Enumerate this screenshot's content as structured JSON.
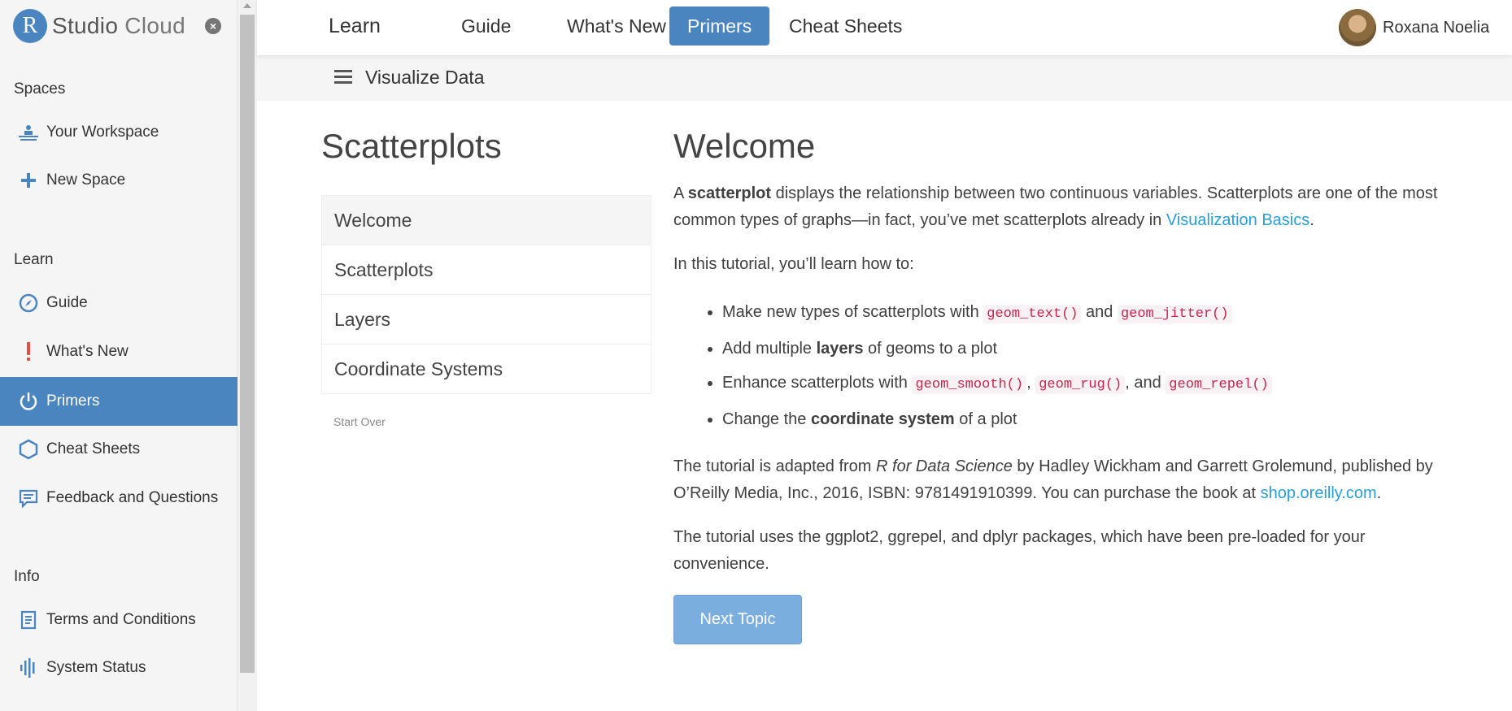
{
  "sidebar": {
    "brand_r": "R",
    "brand_studio": "Studio",
    "brand_cloud": "Cloud",
    "sections": {
      "spaces": "Spaces",
      "learn": "Learn",
      "info": "Info"
    },
    "items": {
      "workspace": "Your Workspace",
      "new_space": "New Space",
      "guide": "Guide",
      "whats_new": "What's New",
      "primers": "Primers",
      "cheat_sheets": "Cheat Sheets",
      "feedback": "Feedback and Questions",
      "terms": "Terms and Conditions",
      "status": "System Status"
    }
  },
  "topnav": {
    "title": "Learn",
    "links": [
      "Guide",
      "What's New",
      "Primers",
      "Cheat Sheets"
    ],
    "active": "Primers",
    "user_name": "Roxana Noelia"
  },
  "subbar": {
    "title": "Visualize Data"
  },
  "toc": {
    "title": "Scatterplots",
    "items": [
      "Welcome",
      "Scatterplots",
      "Layers",
      "Coordinate Systems"
    ],
    "active": "Welcome",
    "start_over": "Start Over"
  },
  "content": {
    "heading": "Welcome",
    "p1_a": "A ",
    "p1_bold": "scatterplot",
    "p1_b": " displays the relationship between two continuous variables. Scatterplots are one of the most common types of graphs—in fact, you’ve met scatterplots already in ",
    "p1_link": "Visualization Basics",
    "p1_c": ".",
    "p2": "In this tutorial, you’ll learn how to:",
    "li1_a": "Make new types of scatterplots with ",
    "li1_code1": "geom_text()",
    "li1_b": " and ",
    "li1_code2": "geom_jitter()",
    "li2_a": "Add multiple ",
    "li2_bold": "layers",
    "li2_b": " of geoms to a plot",
    "li3_a": "Enhance scatterplots with ",
    "li3_code1": "geom_smooth()",
    "li3_b": ", ",
    "li3_code2": "geom_rug()",
    "li3_c": ", and ",
    "li3_code3": "geom_repel()",
    "li4_a": "Change the ",
    "li4_bold": "coordinate system",
    "li4_b": " of a plot",
    "p3_a": "The tutorial is adapted from ",
    "p3_italic": "R for Data Science",
    "p3_b": " by Hadley Wickham and Garrett Grolemund, published by O’Reilly Media, Inc., 2016, ISBN: 9781491910399. You can purchase the book at ",
    "p3_link": "shop.oreilly.com",
    "p3_c": ".",
    "p4": "The tutorial uses the ggplot2, ggrepel, and dplyr packages, which have been pre-loaded for your convenience.",
    "next_button": "Next Topic"
  },
  "colors": {
    "accent": "#4b85c0",
    "link": "#2a9fd6",
    "code": "#c7254e",
    "next_button": "#7aaedf"
  },
  "icons": {
    "workspace": "workspace-icon",
    "new_space": "plus-icon",
    "guide": "compass-icon",
    "whats_new": "exclamation-icon",
    "primers": "power-icon",
    "cheat_sheets": "hexagon-icon",
    "feedback": "chat-icon",
    "terms": "document-icon",
    "status": "signal-bars-icon",
    "close": "close-icon",
    "menu": "hamburger-icon"
  }
}
